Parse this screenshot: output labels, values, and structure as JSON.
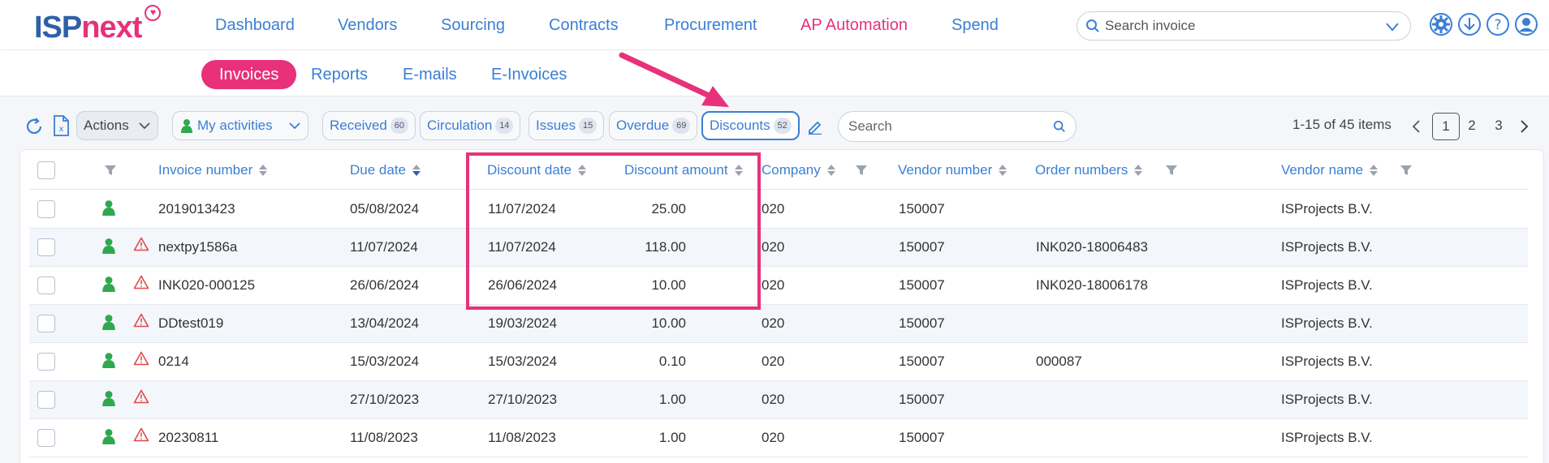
{
  "app": {
    "logo_isp": "ISP",
    "logo_next": "next"
  },
  "nav": [
    "Dashboard",
    "Vendors",
    "Sourcing",
    "Contracts",
    "Procurement",
    "AP Automation",
    "Spend"
  ],
  "nav_active": "AP Automation",
  "search_invoice": {
    "placeholder": "Search invoice"
  },
  "subnav": [
    "Invoices",
    "Reports",
    "E-mails",
    "E-Invoices"
  ],
  "toolbar": {
    "actions_label": "Actions",
    "my_activities_label": "My activities",
    "filters": [
      {
        "label": "Received",
        "count": "60"
      },
      {
        "label": "Circulation",
        "count": "14"
      },
      {
        "label": "Issues",
        "count": "15"
      },
      {
        "label": "Overdue",
        "count": "69"
      },
      {
        "label": "Discounts",
        "count": "52"
      }
    ],
    "selected_filter": "Discounts",
    "search_placeholder": "Search",
    "pager_text": "1-15 of 45 items",
    "pages": [
      "1",
      "2",
      "3"
    ],
    "current_page": "1"
  },
  "table": {
    "columns": [
      "Invoice number",
      "Due date",
      "Discount date",
      "Discount amount",
      "Company",
      "Vendor number",
      "Order numbers",
      "Vendor name"
    ],
    "sort_column": "Due date",
    "sort_direction": "descending",
    "rows": [
      {
        "warning": false,
        "invoice": "2019013423",
        "due": "05/08/2024",
        "disc_date": "11/07/2024",
        "disc_amt": "25.00",
        "company": "020",
        "vendor_no": "150007",
        "orders": "",
        "vendor": "ISProjects B.V."
      },
      {
        "warning": true,
        "invoice": "nextpy1586a",
        "due": "11/07/2024",
        "disc_date": "11/07/2024",
        "disc_amt": "118.00",
        "company": "020",
        "vendor_no": "150007",
        "orders": "INK020-18006483",
        "vendor": "ISProjects B.V."
      },
      {
        "warning": true,
        "invoice": "INK020-000125",
        "due": "26/06/2024",
        "disc_date": "26/06/2024",
        "disc_amt": "10.00",
        "company": "020",
        "vendor_no": "150007",
        "orders": "INK020-18006178",
        "vendor": "ISProjects B.V."
      },
      {
        "warning": true,
        "invoice": "DDtest019",
        "due": "13/04/2024",
        "disc_date": "19/03/2024",
        "disc_amt": "10.00",
        "company": "020",
        "vendor_no": "150007",
        "orders": "",
        "vendor": "ISProjects B.V."
      },
      {
        "warning": true,
        "invoice": "0214",
        "due": "15/03/2024",
        "disc_date": "15/03/2024",
        "disc_amt": "0.10",
        "company": "020",
        "vendor_no": "150007",
        "orders": "000087",
        "vendor": "ISProjects B.V."
      },
      {
        "warning": true,
        "invoice": "",
        "due": "27/10/2023",
        "disc_date": "27/10/2023",
        "disc_amt": "1.00",
        "company": "020",
        "vendor_no": "150007",
        "orders": "",
        "vendor": "ISProjects B.V."
      },
      {
        "warning": true,
        "invoice": "20230811",
        "due": "11/08/2023",
        "disc_date": "11/08/2023",
        "disc_amt": "1.00",
        "company": "020",
        "vendor_no": "150007",
        "orders": "",
        "vendor": "ISProjects B.V."
      }
    ]
  },
  "colors": {
    "brand_blue": "#2f5fa8",
    "link_blue": "#3a7fd5",
    "accent_pink": "#e8317a",
    "ok_green": "#2fa84f",
    "warn_red": "#e0474c"
  },
  "icons": [
    "search-icon",
    "chevron-down-icon",
    "settings-icon",
    "download-icon",
    "help-icon",
    "user-icon",
    "refresh-icon",
    "excel-export-icon",
    "person-icon",
    "edit-icon",
    "warning-icon",
    "filter-icon",
    "chevron-left-icon",
    "chevron-right-icon"
  ]
}
